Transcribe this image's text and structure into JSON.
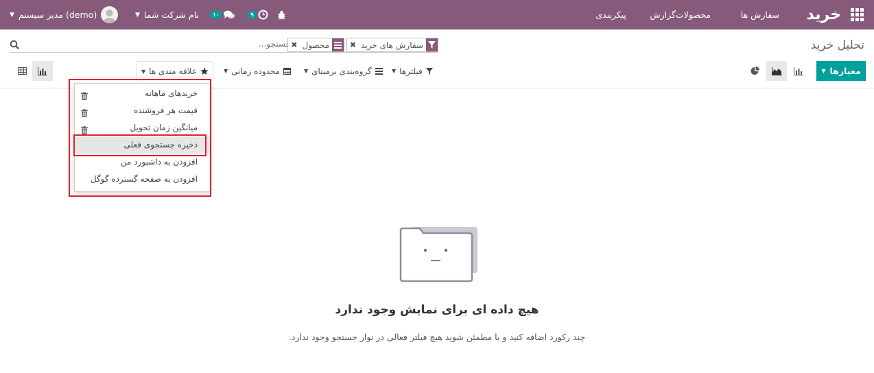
{
  "navbar": {
    "brand": "خرید",
    "menu": [
      "سفارش ها",
      "محصولات",
      "گزارش",
      "پیکربندی"
    ],
    "user_name": "مدیر سیستم (demo)",
    "company_name": "نام شرکت شما",
    "chat_badge": "۱۰",
    "activity_badge": "۹",
    "color": "#875a7b"
  },
  "control_panel": {
    "title": "تحلیل خرید",
    "search_placeholder": "جستجو...",
    "facets": [
      {
        "label": "سفارش های خرید",
        "icon": "filter-icon"
      },
      {
        "label": "محصول",
        "icon": "group-icon"
      }
    ],
    "measures_label": "معیارها",
    "filter_buttons": {
      "filters": "فیلترها",
      "group_by": "گروه‌بندی برمبنای",
      "date_range": "محدوده زمانی",
      "favorites": "علاقه مندی ها"
    },
    "accent_color": "#00a09d"
  },
  "favorites_dropdown": {
    "items": [
      "خریدهای ماهانه",
      "قیمت هر فروشنده",
      "میانگین زمان تحویل",
      "ذخیره جستجوی فعلی",
      "افزودن به داشبورد من",
      "افزودن به صفحه گسترده گوگل"
    ],
    "highlight_color": "#e0202a"
  },
  "empty_state": {
    "title": "هیچ داده ای برای نمایش وجود ندارد",
    "subtitle": "چند رکورد اضافه کنید و یا مطمئن شوید هیچ فیلتر فعالی در نوار جستجو وجود ندارد."
  }
}
